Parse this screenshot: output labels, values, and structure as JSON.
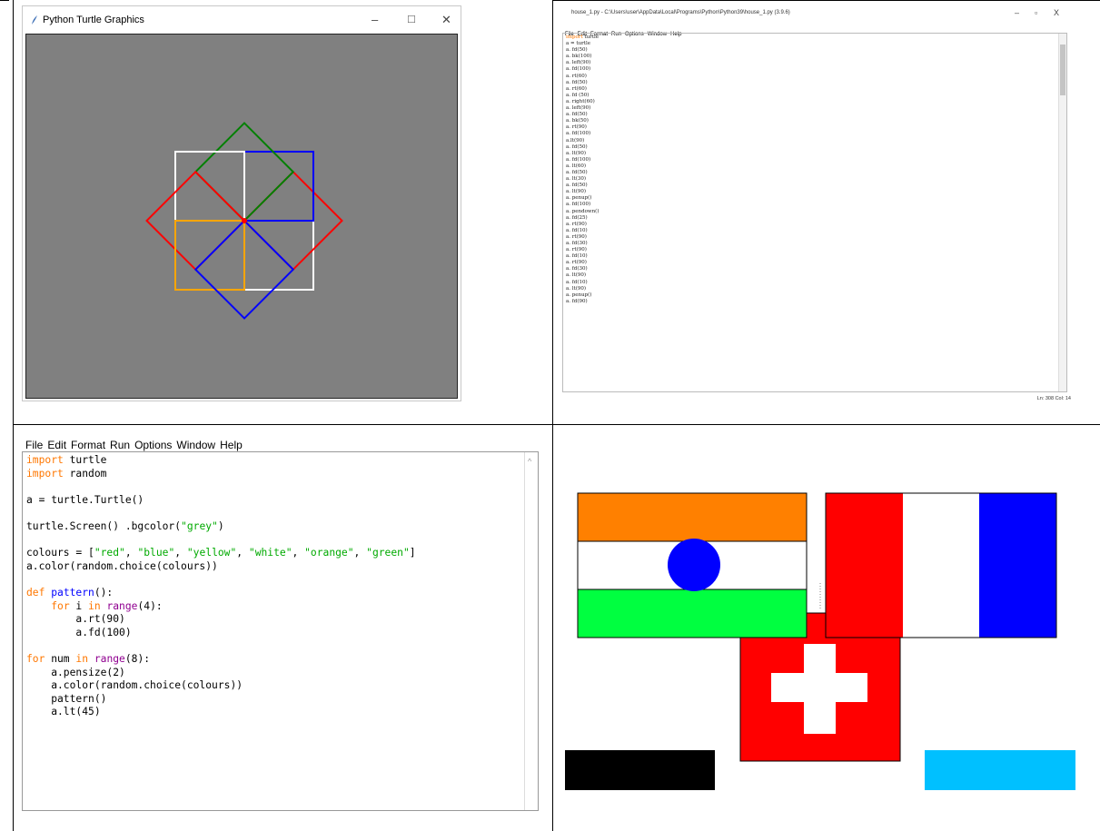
{
  "turtle_window": {
    "title": "Python Turtle Graphics",
    "minimize": "–",
    "maximize": "□",
    "close": "✕",
    "background": "#808080",
    "squares": [
      {
        "color": "#ffffff",
        "angle": 0
      },
      {
        "color": "#ff0000",
        "angle": 45
      },
      {
        "color": "#0000ff",
        "angle": 90
      },
      {
        "color": "#008000",
        "angle": 135
      },
      {
        "color": "#ffffff",
        "angle": 180
      },
      {
        "color": "#ff0000",
        "angle": 225
      },
      {
        "color": "#ffa500",
        "angle": 270
      },
      {
        "color": "#0000ff",
        "angle": 315
      }
    ]
  },
  "idle_top": {
    "title": "house_1.py - C:\\Users\\user\\AppData\\Local\\Programs\\Python\\Python39\\house_1.py (3.9.6)",
    "minimize": "–",
    "maximize": "▫",
    "close": "X",
    "menu": [
      "File",
      "Edit",
      "Format",
      "Run",
      "Options",
      "Window",
      "Help"
    ],
    "code": [
      "import turtle",
      "a = turtle",
      "a. fd(50)",
      "a. bk(100)",
      "a. left(90)",
      "a. fd(100)",
      "a. rt(60)",
      "a. fd(50)",
      "a. rt(60)",
      "a. fd (50)",
      "a. right(60)",
      "a. left(90)",
      "a. fd(50)",
      "a. bk(50)",
      "a. rt(90)",
      "a. fd(100)",
      "a.lt(90)",
      "a. fd(50)",
      "a. lt(90)",
      "a. fd(100)",
      "a. lt(60)",
      "a. fd(50)",
      "a. lt(30)",
      "a. fd(50)",
      "a. lt(90)",
      "a. penup()",
      "a. fd(100)",
      "a. pendown()",
      "a. fd(25)",
      "a. rt(90)",
      "a. fd(10)",
      "a. rt(90)",
      "a. fd(30)",
      "a. rt(90)",
      "a. fd(10)",
      "a. rt(90)",
      "a. fd(30)",
      "a. lt(90)",
      "a. fd(10)",
      "a. lt(90)",
      "a. penup()",
      "a. fd(90)"
    ],
    "status": "Ln: 308   Col: 14"
  },
  "idle_bottom": {
    "menu": [
      "File",
      "Edit",
      "Format",
      "Run",
      "Options",
      "Window",
      "Help"
    ],
    "scroll_up": "^",
    "code": [
      [
        [
          "kw",
          "import"
        ],
        [
          "n",
          " turtle"
        ]
      ],
      [
        [
          "kw",
          "import"
        ],
        [
          "n",
          " random"
        ]
      ],
      [
        [
          "n",
          ""
        ]
      ],
      [
        [
          "n",
          "a = turtle.Turtle()"
        ]
      ],
      [
        [
          "n",
          ""
        ]
      ],
      [
        [
          "n",
          "turtle.Screen() .bgcolor("
        ],
        [
          "str",
          "\"grey\""
        ],
        [
          "n",
          ")"
        ]
      ],
      [
        [
          "n",
          ""
        ]
      ],
      [
        [
          "n",
          "colours = ["
        ],
        [
          "str",
          "\"red\""
        ],
        [
          "n",
          ", "
        ],
        [
          "str",
          "\"blue\""
        ],
        [
          "n",
          ", "
        ],
        [
          "str",
          "\"yellow\""
        ],
        [
          "n",
          ", "
        ],
        [
          "str",
          "\"white\""
        ],
        [
          "n",
          ", "
        ],
        [
          "str",
          "\"orange\""
        ],
        [
          "n",
          ", "
        ],
        [
          "str",
          "\"green\""
        ],
        [
          "n",
          "]"
        ]
      ],
      [
        [
          "n",
          "a.color(random.choice(colours))"
        ]
      ],
      [
        [
          "n",
          ""
        ]
      ],
      [
        [
          "kw",
          "def"
        ],
        [
          "n",
          " "
        ],
        [
          "def",
          "pattern"
        ],
        [
          "n",
          "():"
        ]
      ],
      [
        [
          "n",
          "    "
        ],
        [
          "kw",
          "for"
        ],
        [
          "n",
          " i "
        ],
        [
          "kw",
          "in"
        ],
        [
          "n",
          " "
        ],
        [
          "bi",
          "range"
        ],
        [
          "n",
          "(4):"
        ]
      ],
      [
        [
          "n",
          "        a.rt(90)"
        ]
      ],
      [
        [
          "n",
          "        a.fd(100)"
        ]
      ],
      [
        [
          "n",
          ""
        ]
      ],
      [
        [
          "kw",
          "for"
        ],
        [
          "n",
          " num "
        ],
        [
          "kw",
          "in"
        ],
        [
          "n",
          " "
        ],
        [
          "bi",
          "range"
        ],
        [
          "n",
          "(8):"
        ]
      ],
      [
        [
          "n",
          "    a.pensize(2)"
        ]
      ],
      [
        [
          "n",
          "    a.color(random.choice(colours))"
        ]
      ],
      [
        [
          "n",
          "    pattern()"
        ]
      ],
      [
        [
          "n",
          "    a.lt(45)"
        ]
      ]
    ]
  },
  "flags": {
    "colors": {
      "saffron": "#ff8000",
      "white": "#ffffff",
      "green": "#00ff40",
      "chakra": "#0000ff",
      "red": "#ff0000",
      "blue": "#0000ff",
      "black": "#000000",
      "sky": "#00c0ff"
    }
  }
}
